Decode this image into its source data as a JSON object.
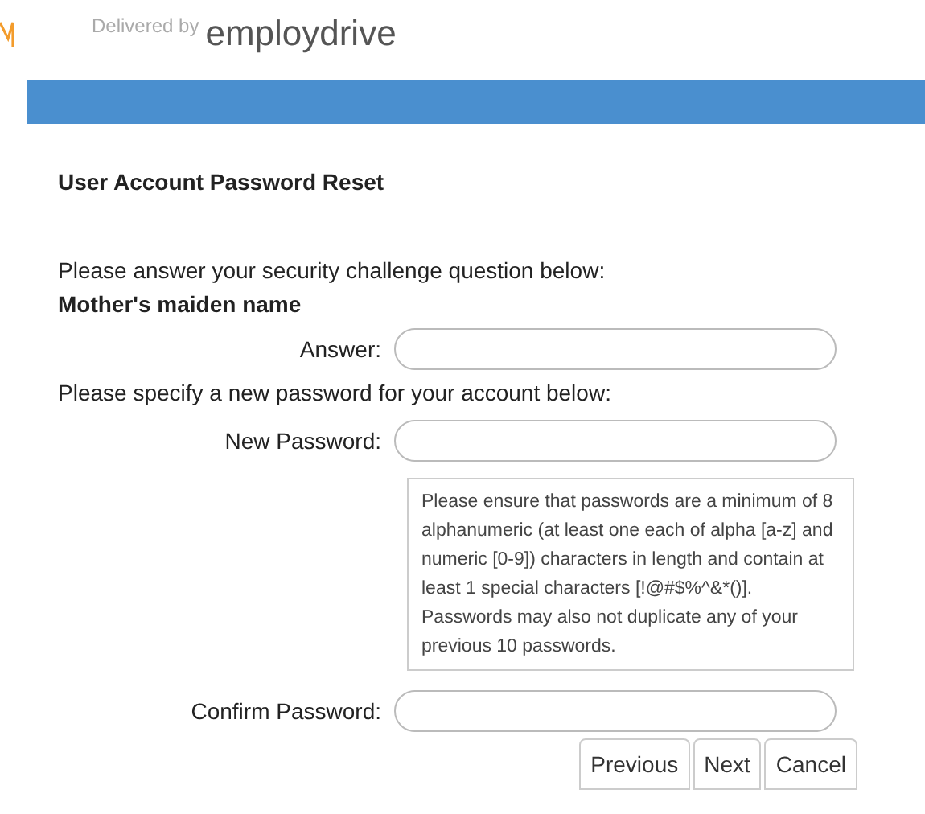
{
  "header": {
    "tagline": "Delivered by",
    "brand": "employdrive"
  },
  "title": "User Account Password Reset",
  "challenge_intro": "Please answer your security challenge question below:",
  "challenge_question": "Mother's maiden name",
  "answer_label": "Answer:",
  "password_intro": "Please specify a new password for your account below:",
  "new_password_label": "New Password:",
  "password_rules": "Please ensure that passwords are a minimum of 8 alphanumeric (at least one each of alpha [a-z] and numeric [0-9]) characters in length and contain at least 1 special characters [!@#$%^&*()]. Passwords may also not duplicate any of your previous 10 passwords.",
  "confirm_password_label": "Confirm Password:",
  "buttons": [
    "Previous",
    "Next",
    "Cancel"
  ]
}
